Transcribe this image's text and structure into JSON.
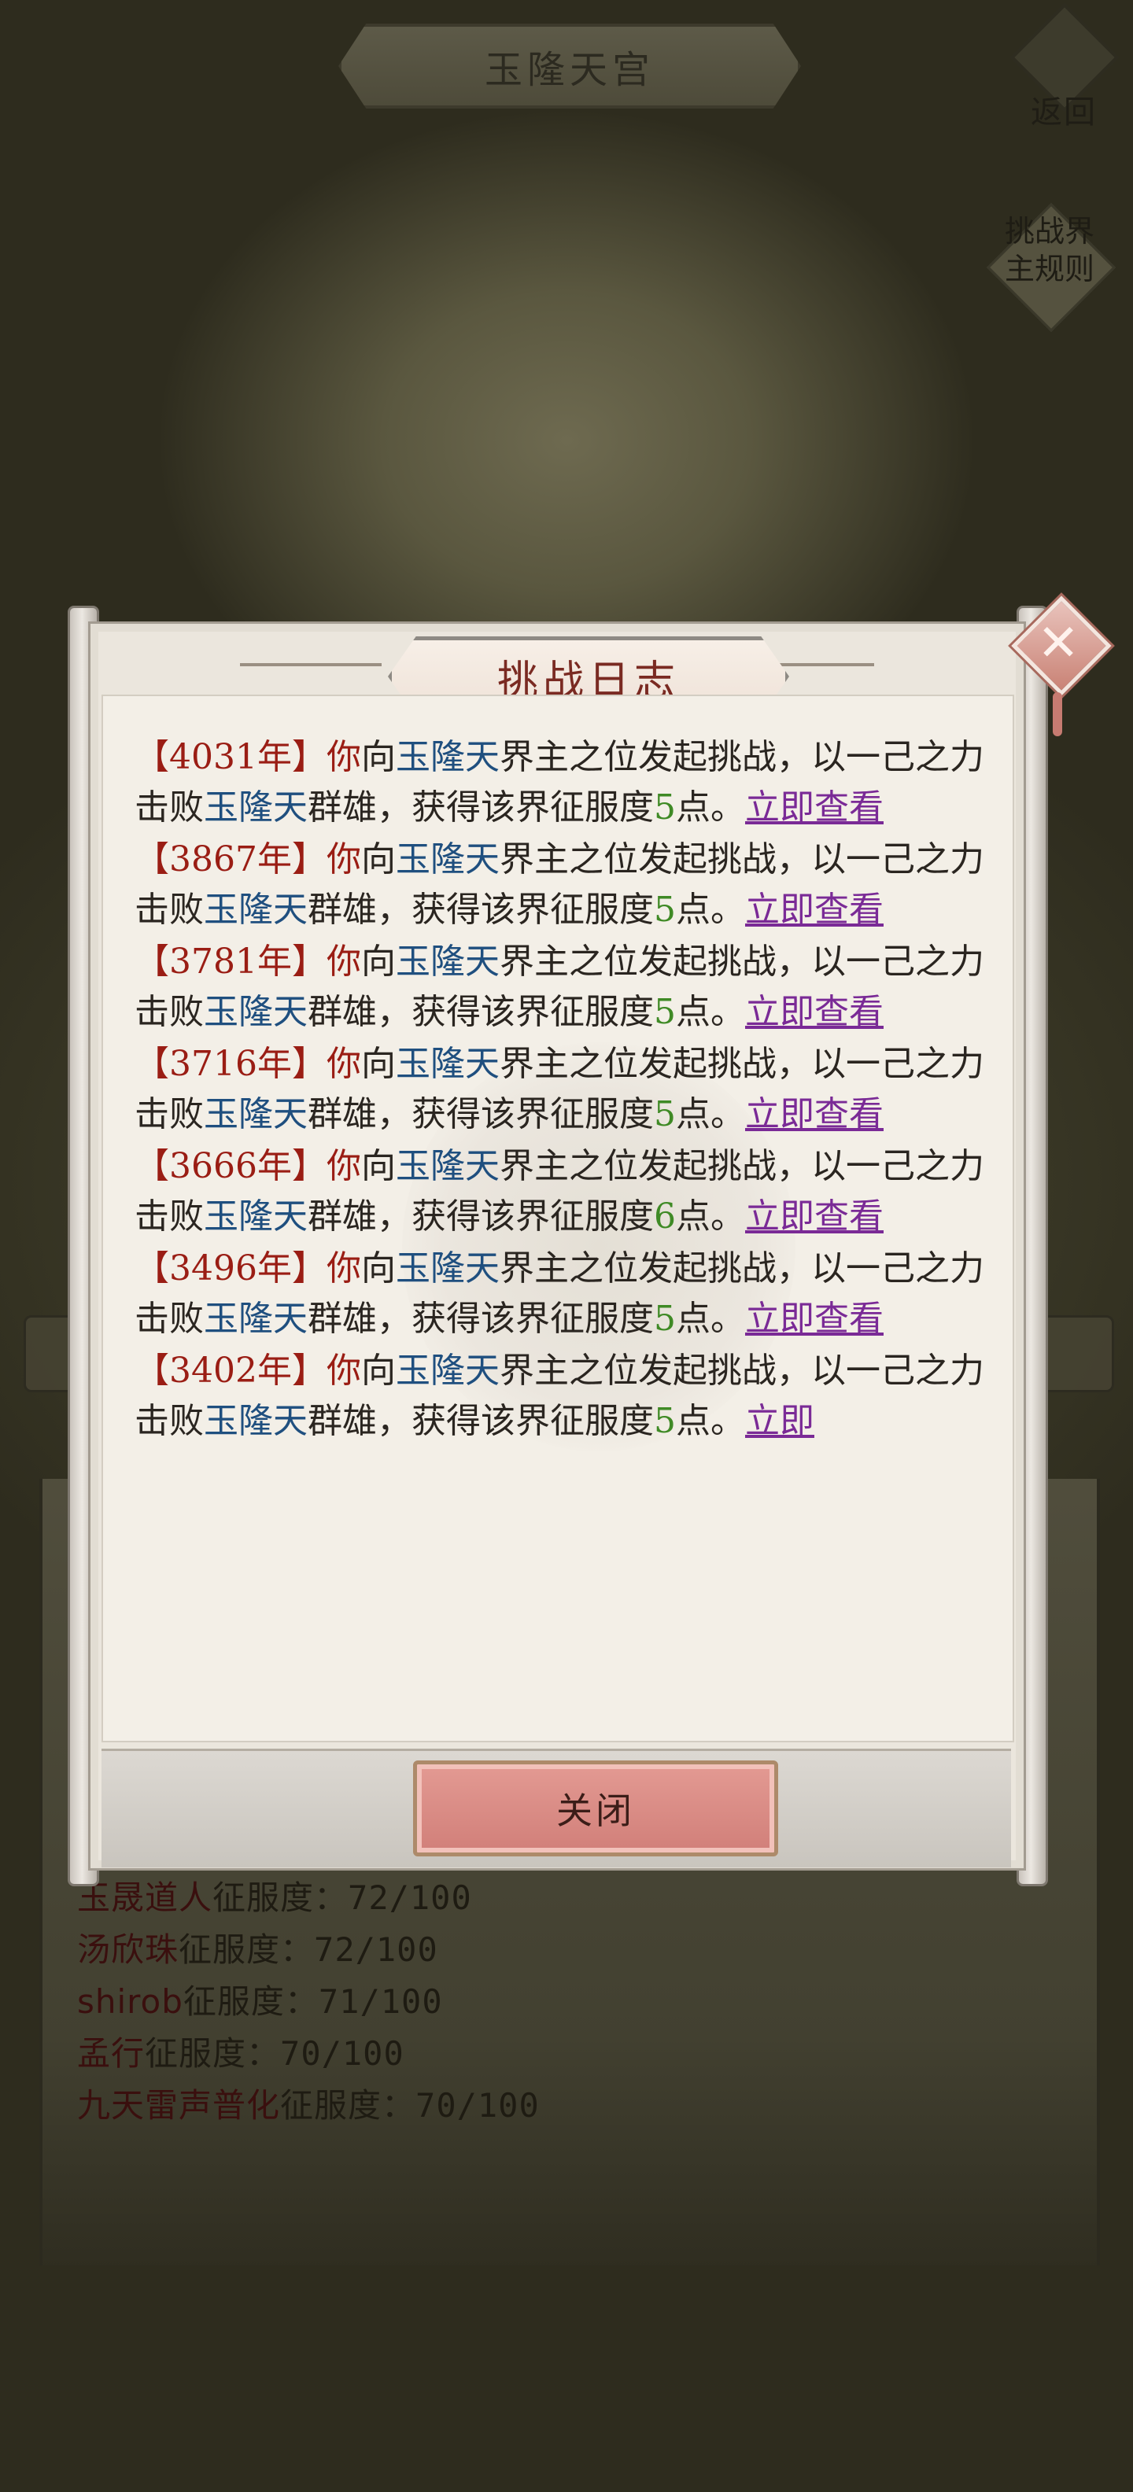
{
  "screen": {
    "title": "玉隆天宫",
    "back_label": "返回",
    "rules_label": "挑战界主规则"
  },
  "background_ranking": [
    {
      "name": "玉晟道人",
      "label": "征服度：",
      "score": "72/100"
    },
    {
      "name": "汤欣珠",
      "label": "征服度：",
      "score": "72/100"
    },
    {
      "name": "shirob",
      "label": "征服度：",
      "score": "71/100"
    },
    {
      "name": "孟行",
      "label": "征服度：",
      "score": "70/100"
    },
    {
      "name": "九天雷声普化",
      "label": "征服度：",
      "score": "70/100"
    }
  ],
  "dialog": {
    "title": "挑战日志",
    "close_button": "关闭",
    "entries": [
      {
        "year": "【4031年】",
        "you": "你",
        "to": "向",
        "place": "玉隆天",
        "text1": "界主之位发起挑战，以一己之力击败",
        "place2": "玉隆天",
        "text2": "群雄，获得该界征服度",
        "points": "5",
        "unit": "点。",
        "link": "立即查看"
      },
      {
        "year": "【3867年】",
        "you": "你",
        "to": "向",
        "place": "玉隆天",
        "text1": "界主之位发起挑战，以一己之力击败",
        "place2": "玉隆天",
        "text2": "群雄，获得该界征服度",
        "points": "5",
        "unit": "点。",
        "link": "立即查看"
      },
      {
        "year": "【3781年】",
        "you": "你",
        "to": "向",
        "place": "玉隆天",
        "text1": "界主之位发起挑战，以一己之力击败",
        "place2": "玉隆天",
        "text2": "群雄，获得该界征服度",
        "points": "5",
        "unit": "点。",
        "link": "立即查看"
      },
      {
        "year": "【3716年】",
        "you": "你",
        "to": "向",
        "place": "玉隆天",
        "text1": "界主之位发起挑战，以一己之力击败",
        "place2": "玉隆天",
        "text2": "群雄，获得该界征服度",
        "points": "5",
        "unit": "点。",
        "link": "立即查看"
      },
      {
        "year": "【3666年】",
        "you": "你",
        "to": "向",
        "place": "玉隆天",
        "text1": "界主之位发起挑战，以一己之力击败",
        "place2": "玉隆天",
        "text2": "群雄，获得该界征服度",
        "points": "6",
        "unit": "点。",
        "link": "立即查看"
      },
      {
        "year": "【3496年】",
        "you": "你",
        "to": "向",
        "place": "玉隆天",
        "text1": "界主之位发起挑战，以一己之力击败",
        "place2": "玉隆天",
        "text2": "群雄，获得该界征服度",
        "points": "5",
        "unit": "点。",
        "link": "立即查看"
      },
      {
        "year": "【3402年】",
        "you": "你",
        "to": "向",
        "place": "玉隆天",
        "text1": "界主之位发起挑战，以一己之力击败",
        "place2": "玉隆天",
        "text2": "群雄，获得该界征服度",
        "points": "5",
        "unit": "点。",
        "link": "立即"
      }
    ]
  },
  "colors": {
    "year": "#9a1d14",
    "place": "#1f4f7f",
    "points": "#3f8a25",
    "link": "#7a2a96",
    "title": "#7a2a22"
  }
}
